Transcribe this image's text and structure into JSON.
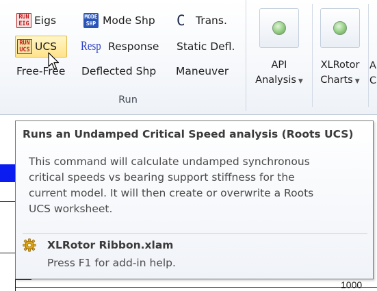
{
  "ribbon": {
    "run_group": {
      "label": "Run",
      "buttons": [
        {
          "label": "Eigs",
          "icon": "run-eig-icon",
          "icon_text": [
            "RUN",
            "EIG"
          ]
        },
        {
          "label": "Mode Shp",
          "icon": "mode-shp-icon",
          "icon_text": [
            "MODE",
            "SHP"
          ]
        },
        {
          "label": "Trans.",
          "icon": "trans-icon",
          "icon_text": "C"
        },
        {
          "label": "UCS",
          "icon": "run-ucs-icon",
          "icon_text": [
            "RUN",
            "UCS"
          ],
          "state": "hover"
        },
        {
          "label": "Response",
          "icon": "resp-icon",
          "icon_text": "Resp"
        },
        {
          "label": "Static Defl."
        },
        {
          "label": "Free-Free"
        },
        {
          "label": "Deflected Shp"
        },
        {
          "label": "Maneuver"
        }
      ]
    },
    "big_buttons": [
      {
        "label_line1": "API",
        "label_line2": "Analysis",
        "icon": "green-gem-icon",
        "has_dropdown": true
      },
      {
        "label_line1": "XLRotor",
        "label_line2": "Charts",
        "icon": "green-gem-icon",
        "has_dropdown": true
      },
      {
        "label_line1": "A",
        "label_line2": "C"
      }
    ]
  },
  "sheet": {
    "visible_value": "1000",
    "highlight_color": "#0a1cf0"
  },
  "tooltip": {
    "title": "Runs an Undamped Critical Speed analysis (Roots UCS)",
    "body_lines": [
      "This command will calculate undamped synchronous",
      "critical speeds vs bearing support stiffness for the",
      "current model. It will then create or overwrite a Roots",
      "UCS worksheet."
    ],
    "addin_file": "XLRotor Ribbon.xlam",
    "help_text": "Press F1 for add-in help."
  }
}
